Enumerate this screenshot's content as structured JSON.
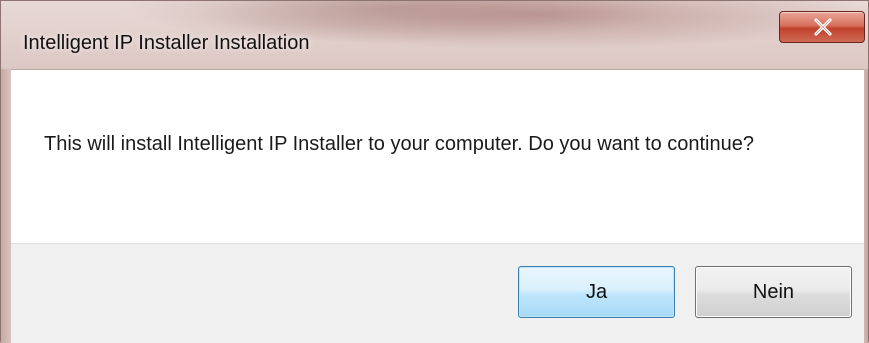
{
  "dialog": {
    "title": "Intelligent IP Installer Installation",
    "message": "This will install Intelligent IP Installer to your computer. Do you want to continue?",
    "buttons": {
      "yes_label": "Ja",
      "no_label": "Nein"
    },
    "close_icon": "close-icon"
  },
  "colors": {
    "close_button": "#c0412c",
    "default_button_border": "#3c7fb1",
    "content_bg": "#ffffff",
    "footer_bg": "#f0f0f0"
  }
}
